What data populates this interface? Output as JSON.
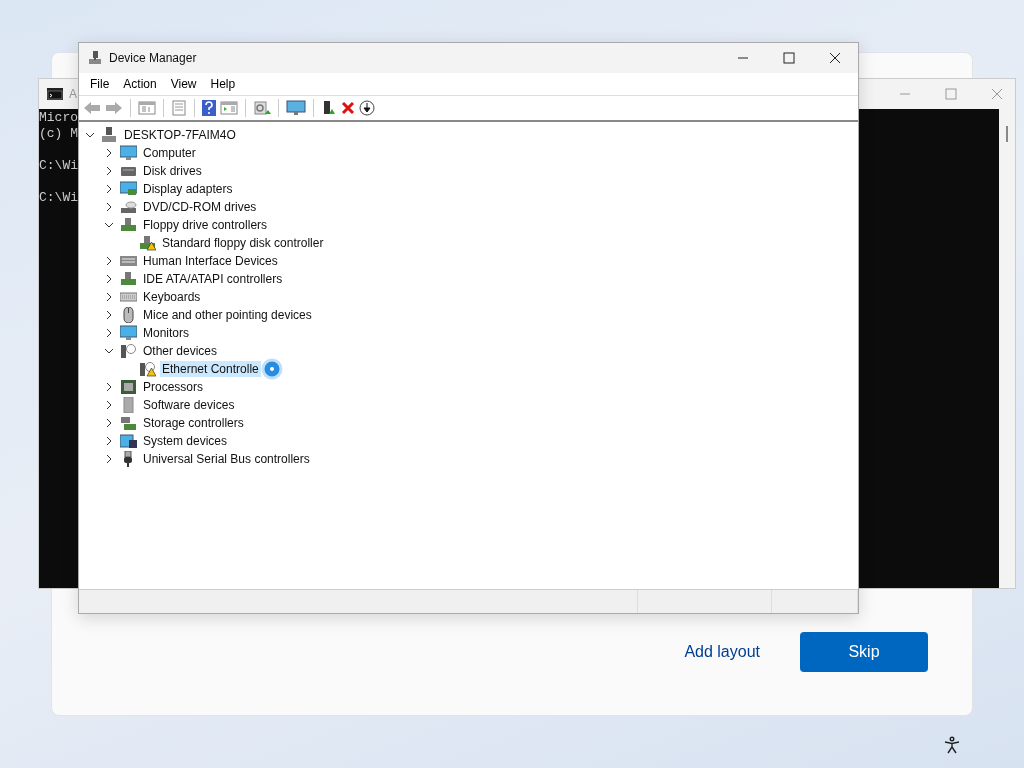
{
  "setup_dialog": {
    "link": "Add layout",
    "button": "Skip"
  },
  "console_window": {
    "title": "A",
    "paragraphs": [
      [
        "Micro",
        "(c) M"
      ],
      [
        "C:\\Wi"
      ],
      [
        "C:\\Wi"
      ]
    ]
  },
  "device_manager": {
    "title": "Device Manager",
    "menu": [
      "File",
      "Action",
      "View",
      "Help"
    ],
    "tree": [
      {
        "label": "DESKTOP-7FAIM4O",
        "kind": "pc",
        "expanded": true,
        "selected": false,
        "children": [
          {
            "label": "Computer",
            "kind": "monitor",
            "expanded": false,
            "selected": false
          },
          {
            "label": "Disk drives",
            "kind": "disk",
            "expanded": false,
            "selected": false
          },
          {
            "label": "Display adapters",
            "kind": "display",
            "expanded": false,
            "selected": false
          },
          {
            "label": "DVD/CD-ROM drives",
            "kind": "dvd",
            "expanded": false,
            "selected": false
          },
          {
            "label": "Floppy drive controllers",
            "kind": "card",
            "expanded": true,
            "selected": false,
            "children": [
              {
                "label": "Standard floppy disk controller",
                "kind": "card",
                "warning": true,
                "selected": false
              }
            ]
          },
          {
            "label": "Human Interface Devices",
            "kind": "hid",
            "expanded": false,
            "selected": false
          },
          {
            "label": "IDE ATA/ATAPI controllers",
            "kind": "card",
            "expanded": false,
            "selected": false
          },
          {
            "label": "Keyboards",
            "kind": "keyboard",
            "expanded": false,
            "selected": false
          },
          {
            "label": "Mice and other pointing devices",
            "kind": "mouse",
            "expanded": false,
            "selected": false
          },
          {
            "label": "Monitors",
            "kind": "monitor",
            "expanded": false,
            "selected": false
          },
          {
            "label": "Other devices",
            "kind": "unknown",
            "expanded": true,
            "selected": false,
            "children": [
              {
                "label": "Ethernet Controlle",
                "kind": "unknown",
                "warning": true,
                "selected": true
              }
            ]
          },
          {
            "label": "Processors",
            "kind": "chip",
            "expanded": false,
            "selected": false
          },
          {
            "label": "Software devices",
            "kind": "box",
            "expanded": false,
            "selected": false
          },
          {
            "label": "Storage controllers",
            "kind": "storage",
            "expanded": false,
            "selected": false
          },
          {
            "label": "System devices",
            "kind": "system",
            "expanded": false,
            "selected": false
          },
          {
            "label": "Universal Serial Bus controllers",
            "kind": "usb",
            "expanded": false,
            "selected": false
          }
        ]
      }
    ]
  }
}
